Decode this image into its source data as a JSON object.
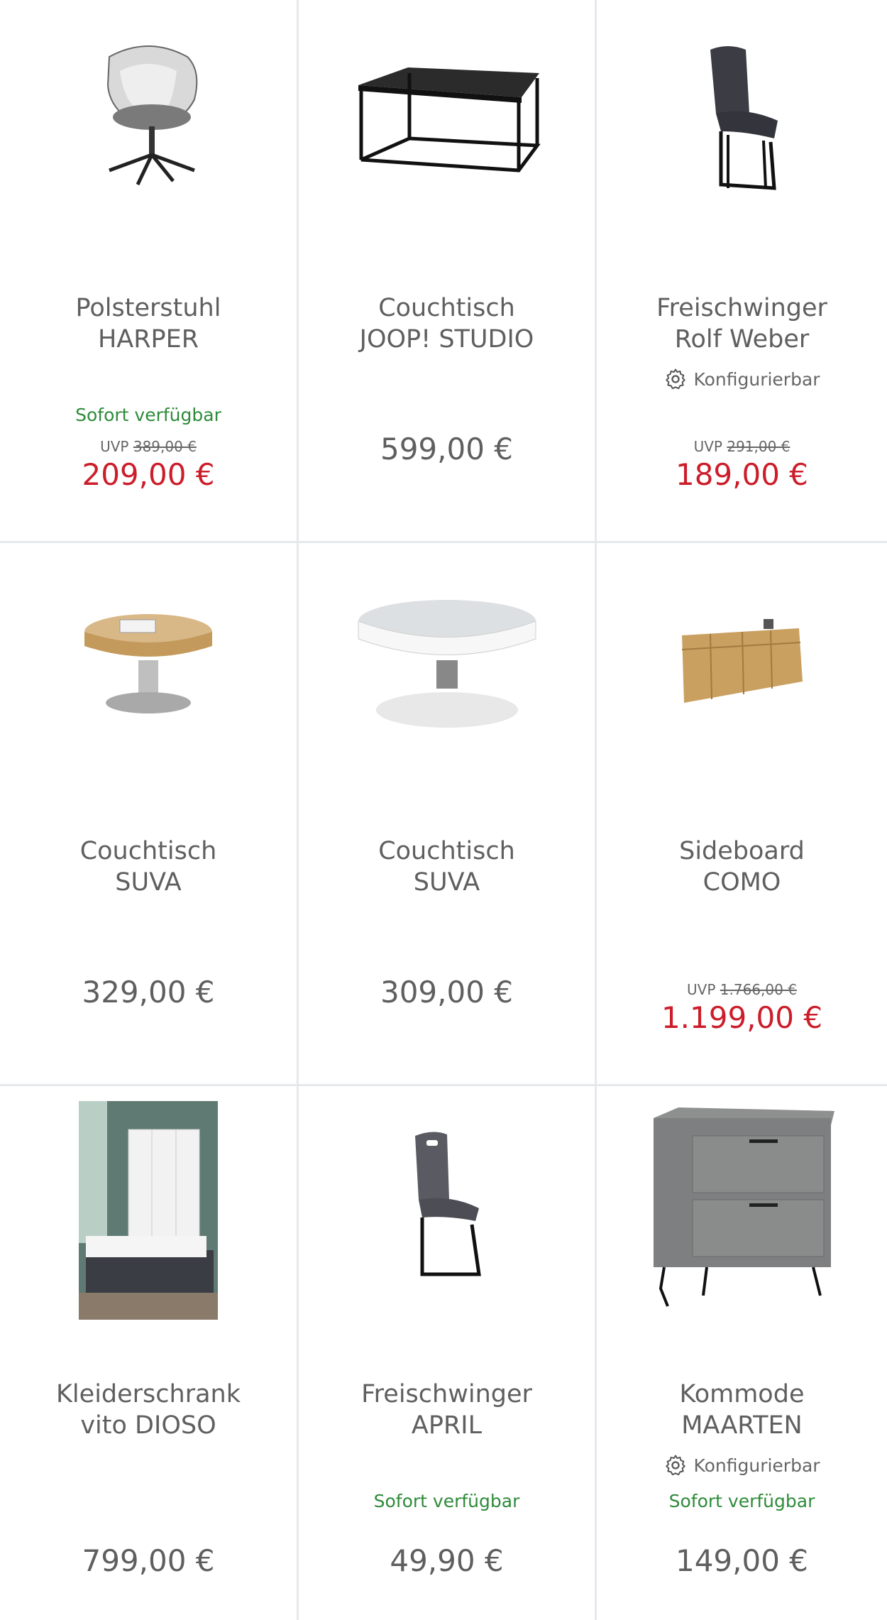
{
  "products": [
    {
      "name1": "Polsterstuhl",
      "name2": "HARPER",
      "available": "Sofort verfügbar",
      "uvp_label": "UVP",
      "uvp": "389,00 €",
      "price": "209,00 €",
      "icon": "swivel-armchair"
    },
    {
      "name1": "Couchtisch",
      "name2": "JOOP! STUDIO",
      "price": "599,00 €",
      "icon": "square-coffee-table"
    },
    {
      "name1": "Freischwinger",
      "name2": "Rolf Weber",
      "config": "Konfigurierbar",
      "uvp_label": "UVP",
      "uvp": "291,00 €",
      "price": "189,00 €",
      "icon": "cantilever-chair"
    },
    {
      "name1": "Couchtisch",
      "name2": "SUVA",
      "price": "329,00 €",
      "icon": "round-oak-table"
    },
    {
      "name1": "Couchtisch",
      "name2": "SUVA",
      "price": "309,00 €",
      "icon": "round-white-table"
    },
    {
      "name1": "Sideboard",
      "name2": "COMO",
      "uvp_label": "UVP",
      "uvp": "1.766,00 €",
      "price": "1.199,00 €",
      "icon": "oak-sideboard"
    },
    {
      "name1": "Kleiderschrank",
      "name2": "vito DIOSO",
      "price": "799,00 €",
      "icon": "bedroom-wardrobe-photo"
    },
    {
      "name1": "Freischwinger",
      "name2": "APRIL",
      "available": "Sofort verfügbar",
      "price": "49,90 €",
      "icon": "grey-cantilever-chair"
    },
    {
      "name1": "Kommode",
      "name2": "MAARTEN",
      "config": "Konfigurierbar",
      "available": "Sofort verfügbar",
      "price": "149,00 €",
      "icon": "grey-commode"
    }
  ],
  "colors": {
    "sale": "#cc1d2a",
    "available": "#2e8b3a",
    "divider": "#e6e9ec",
    "text": "#5f5f5f"
  }
}
